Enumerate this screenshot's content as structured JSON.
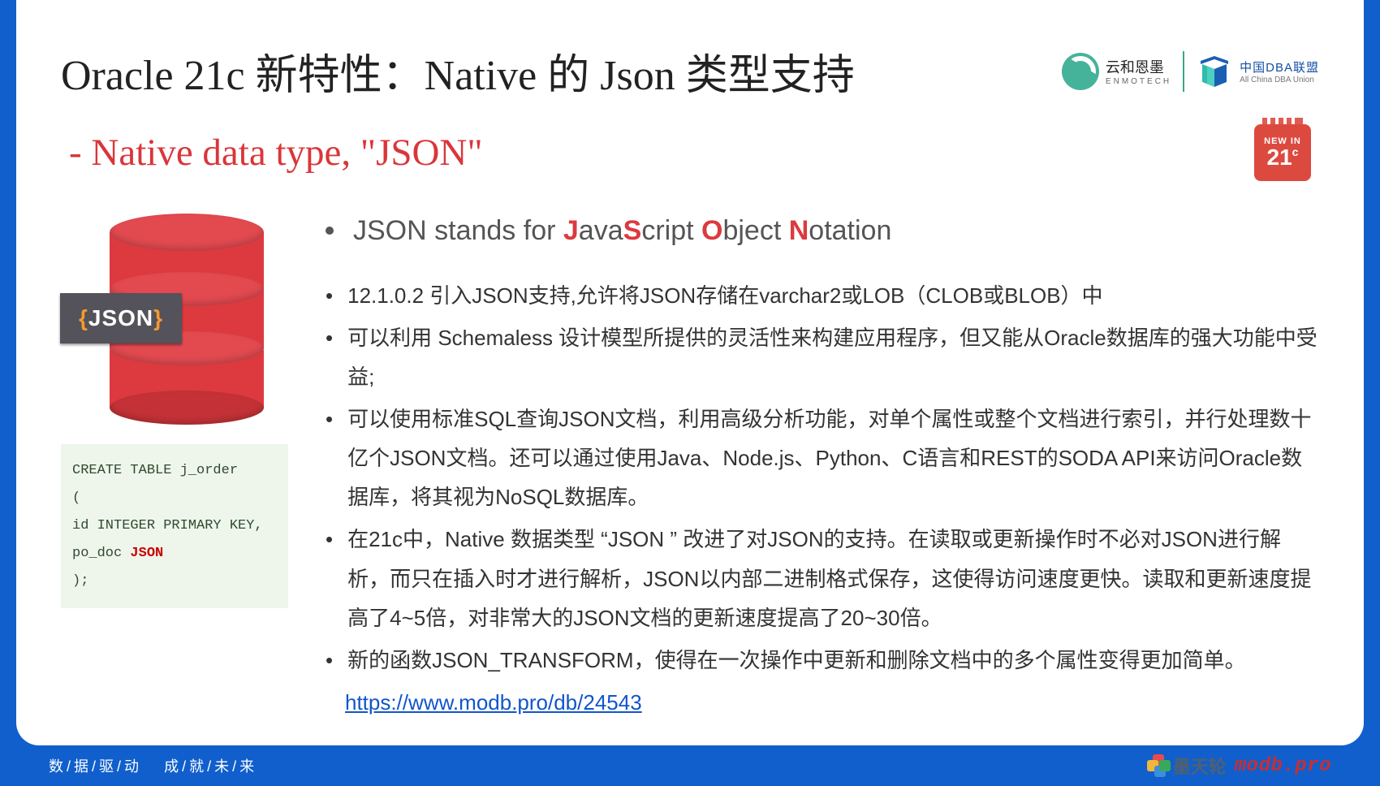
{
  "title": "Oracle 21c 新特性：Native 的 Json 类型支持",
  "subtitle": "- Native data type, \"JSON\"",
  "logos": {
    "enmotech_cn": "云和恩墨",
    "enmotech_en": "ENMOTECH",
    "dba_cn": "中国DBA联盟",
    "dba_en": "All China DBA Union"
  },
  "badge": {
    "top": "NEW IN",
    "version": "21",
    "suffix": "c"
  },
  "json_tag": {
    "open": "{",
    "word": "JSON",
    "close": "}"
  },
  "code": {
    "l1": "CREATE TABLE j_order",
    "l2": "(",
    "l3": "id INTEGER PRIMARY KEY,",
    "l4a": "po_doc ",
    "l4b": "JSON",
    "l5": " );"
  },
  "lead": {
    "prefix": "JSON ",
    "stands": "stands for ",
    "j": "J",
    "ava": "ava",
    "s": "S",
    "cript": "cript ",
    "o": "O",
    "bject": "bject ",
    "n": "N",
    "otation": "otation"
  },
  "bullets": [
    "12.1.0.2 引入JSON支持,允许将JSON存储在varchar2或LOB（CLOB或BLOB）中",
    "可以利用 Schemaless 设计模型所提供的灵活性来构建应用程序，但又能从Oracle数据库的强大功能中受益;",
    "可以使用标准SQL查询JSON文档，利用高级分析功能，对单个属性或整个文档进行索引，并行处理数十亿个JSON文档。还可以通过使用Java、Node.js、Python、C语言和REST的SODA API来访问Oracle数据库，将其视为NoSQL数据库。",
    "在21c中，Native 数据类型 “JSON ” 改进了对JSON的支持。在读取或更新操作时不必对JSON进行解析，而只在插入时才进行解析，JSON以内部二进制格式保存，这使得访问速度更快。读取和更新速度提高了4~5倍，对非常大的JSON文档的更新速度提高了20~30倍。",
    "新的函数JSON_TRANSFORM，使得在一次操作中更新和删除文档中的多个属性变得更加简单。"
  ],
  "link": "https://www.modb.pro/db/24543",
  "footer": {
    "left_parts": [
      "数",
      "据",
      "驱",
      "动",
      "",
      "成",
      "就",
      "未",
      "来"
    ],
    "mtl": "墨天轮",
    "modb": "modb.pro"
  }
}
